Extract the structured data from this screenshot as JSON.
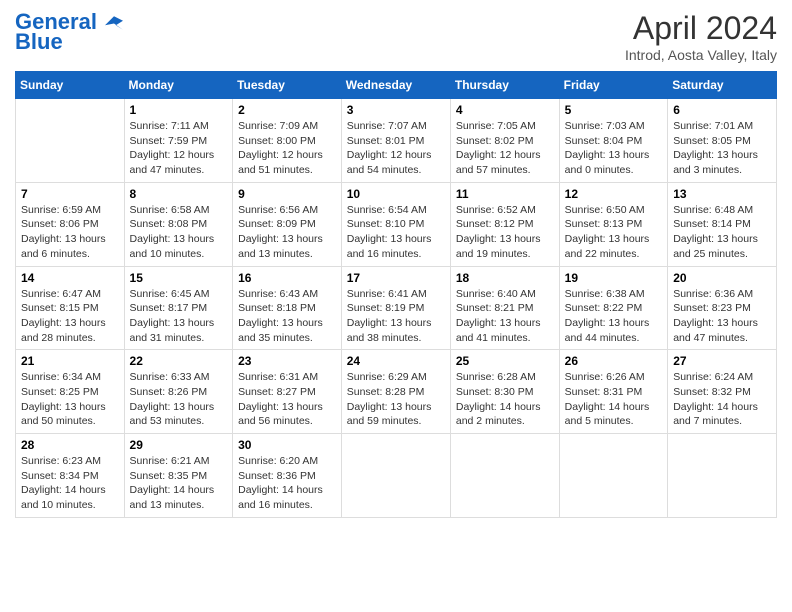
{
  "header": {
    "logo_line1": "General",
    "logo_line2": "Blue",
    "month": "April 2024",
    "location": "Introd, Aosta Valley, Italy"
  },
  "days_of_week": [
    "Sunday",
    "Monday",
    "Tuesday",
    "Wednesday",
    "Thursday",
    "Friday",
    "Saturday"
  ],
  "weeks": [
    [
      {
        "num": "",
        "detail": ""
      },
      {
        "num": "1",
        "detail": "Sunrise: 7:11 AM\nSunset: 7:59 PM\nDaylight: 12 hours\nand 47 minutes."
      },
      {
        "num": "2",
        "detail": "Sunrise: 7:09 AM\nSunset: 8:00 PM\nDaylight: 12 hours\nand 51 minutes."
      },
      {
        "num": "3",
        "detail": "Sunrise: 7:07 AM\nSunset: 8:01 PM\nDaylight: 12 hours\nand 54 minutes."
      },
      {
        "num": "4",
        "detail": "Sunrise: 7:05 AM\nSunset: 8:02 PM\nDaylight: 12 hours\nand 57 minutes."
      },
      {
        "num": "5",
        "detail": "Sunrise: 7:03 AM\nSunset: 8:04 PM\nDaylight: 13 hours\nand 0 minutes."
      },
      {
        "num": "6",
        "detail": "Sunrise: 7:01 AM\nSunset: 8:05 PM\nDaylight: 13 hours\nand 3 minutes."
      }
    ],
    [
      {
        "num": "7",
        "detail": "Sunrise: 6:59 AM\nSunset: 8:06 PM\nDaylight: 13 hours\nand 6 minutes."
      },
      {
        "num": "8",
        "detail": "Sunrise: 6:58 AM\nSunset: 8:08 PM\nDaylight: 13 hours\nand 10 minutes."
      },
      {
        "num": "9",
        "detail": "Sunrise: 6:56 AM\nSunset: 8:09 PM\nDaylight: 13 hours\nand 13 minutes."
      },
      {
        "num": "10",
        "detail": "Sunrise: 6:54 AM\nSunset: 8:10 PM\nDaylight: 13 hours\nand 16 minutes."
      },
      {
        "num": "11",
        "detail": "Sunrise: 6:52 AM\nSunset: 8:12 PM\nDaylight: 13 hours\nand 19 minutes."
      },
      {
        "num": "12",
        "detail": "Sunrise: 6:50 AM\nSunset: 8:13 PM\nDaylight: 13 hours\nand 22 minutes."
      },
      {
        "num": "13",
        "detail": "Sunrise: 6:48 AM\nSunset: 8:14 PM\nDaylight: 13 hours\nand 25 minutes."
      }
    ],
    [
      {
        "num": "14",
        "detail": "Sunrise: 6:47 AM\nSunset: 8:15 PM\nDaylight: 13 hours\nand 28 minutes."
      },
      {
        "num": "15",
        "detail": "Sunrise: 6:45 AM\nSunset: 8:17 PM\nDaylight: 13 hours\nand 31 minutes."
      },
      {
        "num": "16",
        "detail": "Sunrise: 6:43 AM\nSunset: 8:18 PM\nDaylight: 13 hours\nand 35 minutes."
      },
      {
        "num": "17",
        "detail": "Sunrise: 6:41 AM\nSunset: 8:19 PM\nDaylight: 13 hours\nand 38 minutes."
      },
      {
        "num": "18",
        "detail": "Sunrise: 6:40 AM\nSunset: 8:21 PM\nDaylight: 13 hours\nand 41 minutes."
      },
      {
        "num": "19",
        "detail": "Sunrise: 6:38 AM\nSunset: 8:22 PM\nDaylight: 13 hours\nand 44 minutes."
      },
      {
        "num": "20",
        "detail": "Sunrise: 6:36 AM\nSunset: 8:23 PM\nDaylight: 13 hours\nand 47 minutes."
      }
    ],
    [
      {
        "num": "21",
        "detail": "Sunrise: 6:34 AM\nSunset: 8:25 PM\nDaylight: 13 hours\nand 50 minutes."
      },
      {
        "num": "22",
        "detail": "Sunrise: 6:33 AM\nSunset: 8:26 PM\nDaylight: 13 hours\nand 53 minutes."
      },
      {
        "num": "23",
        "detail": "Sunrise: 6:31 AM\nSunset: 8:27 PM\nDaylight: 13 hours\nand 56 minutes."
      },
      {
        "num": "24",
        "detail": "Sunrise: 6:29 AM\nSunset: 8:28 PM\nDaylight: 13 hours\nand 59 minutes."
      },
      {
        "num": "25",
        "detail": "Sunrise: 6:28 AM\nSunset: 8:30 PM\nDaylight: 14 hours\nand 2 minutes."
      },
      {
        "num": "26",
        "detail": "Sunrise: 6:26 AM\nSunset: 8:31 PM\nDaylight: 14 hours\nand 5 minutes."
      },
      {
        "num": "27",
        "detail": "Sunrise: 6:24 AM\nSunset: 8:32 PM\nDaylight: 14 hours\nand 7 minutes."
      }
    ],
    [
      {
        "num": "28",
        "detail": "Sunrise: 6:23 AM\nSunset: 8:34 PM\nDaylight: 14 hours\nand 10 minutes."
      },
      {
        "num": "29",
        "detail": "Sunrise: 6:21 AM\nSunset: 8:35 PM\nDaylight: 14 hours\nand 13 minutes."
      },
      {
        "num": "30",
        "detail": "Sunrise: 6:20 AM\nSunset: 8:36 PM\nDaylight: 14 hours\nand 16 minutes."
      },
      {
        "num": "",
        "detail": ""
      },
      {
        "num": "",
        "detail": ""
      },
      {
        "num": "",
        "detail": ""
      },
      {
        "num": "",
        "detail": ""
      }
    ]
  ]
}
